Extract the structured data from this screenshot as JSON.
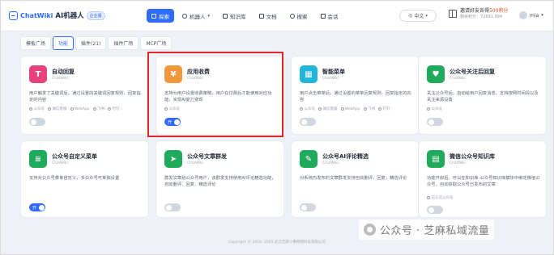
{
  "header": {
    "logo_text": "ChatWiki",
    "logo_title": "AI机器人",
    "logo_badge": "企业版",
    "nav": [
      {
        "label": "探索",
        "active": true
      },
      {
        "label": "机器人",
        "active": false
      },
      {
        "label": "知识库",
        "active": false
      },
      {
        "label": "文档",
        "active": false
      },
      {
        "label": "搜索",
        "active": false
      },
      {
        "label": "会话",
        "active": false
      }
    ],
    "language": "中文",
    "invite_text": "邀请好友各得",
    "invite_points": "500积分",
    "invite_sub": "剩余积分：72891.994",
    "username": "mia"
  },
  "tabs": [
    {
      "label": "模板广场",
      "active": false
    },
    {
      "label": "功能",
      "active": true
    },
    {
      "label": "插件(21)",
      "active": false
    },
    {
      "label": "插件广场",
      "active": false
    },
    {
      "label": "MCP广场",
      "active": false
    }
  ],
  "cards": [
    {
      "title": "自动回复",
      "sub": "ChatWiki",
      "icon": "reply-icon",
      "color": "#e8427a",
      "desc": "用户触发了关键词后，通过设置的关键词回复规则，回复指定的内容",
      "platforms": [
        "公众号",
        "微信客服",
        "WebApp",
        "飞书",
        "钉钉"
      ],
      "toggle_on": false,
      "toggle_label": ""
    },
    {
      "title": "应用收费",
      "sub": "ChatWiki",
      "icon": "yen-icon",
      "color": "#f1983c",
      "desc": "支持为用户设置收费策略，用户在付费后才能使用对应功能，实现AI能力变现",
      "platforms": [
        "公众号"
      ],
      "toggle_on": true,
      "toggle_label": "开"
    },
    {
      "title": "智能菜单",
      "sub": "ChatWiki",
      "icon": "menu-grid-icon",
      "color": "#23b6d9",
      "desc": "用户点击菜单后，通过设置的菜单回复规则，回复指定的内容",
      "platforms": [
        "公众号",
        "微信客服",
        "WebApp",
        "飞书",
        "钉钉"
      ],
      "toggle_on": false,
      "toggle_label": ""
    },
    {
      "title": "公众号关注后回复",
      "sub": "ChatWiki",
      "icon": "heart-chat-icon",
      "color": "#1faa5c",
      "desc": "关注公众号后，自动给用户回复消息，支持按照时间段以及关注来源设置",
      "platforms": [
        "公众号"
      ],
      "toggle_on": false,
      "toggle_label": ""
    },
    {
      "title": "公众号自定义菜单",
      "sub": "ChatWiki",
      "icon": "custom-menu-icon",
      "color": "#1faa5c",
      "desc": "支持对公众号菜单自定义，多公众号可单独设置",
      "platforms": [],
      "toggle_on": true,
      "toggle_label": "开"
    },
    {
      "title": "公众号文章群发",
      "sub": "ChatWiki",
      "icon": "send-icon",
      "color": "#1faa5c",
      "desc": "群发文章给公众号用户，该群发支持使用AI评论精选功能，自动删评、回复、精选评论",
      "platforms": [],
      "toggle_on": false,
      "toggle_label": ""
    },
    {
      "title": "公众号AI评论精选",
      "sub": "ChatWiki",
      "icon": "ai-comment-icon",
      "color": "#1faa5c",
      "desc": "对系统内发布的文章群发支持自动删评，回复，精选评论",
      "platforms": [],
      "toggle_on": false,
      "toggle_label": ""
    },
    {
      "title": "微信公众号知识库",
      "sub": "ChatWiki",
      "icon": "doc-library-icon",
      "color": "#1faa5c",
      "desc": "功能开启后，可以在知识库-公众号知识库模块中绑定微信公众号，自动获取公众号已发布的文章",
      "platforms": [
        "已认证公众号"
      ],
      "toggle_on": false,
      "toggle_label": ""
    }
  ],
  "footer": "Copyright © 2016- 2025 武汉芝麻小事网络科技有限公司",
  "watermark": "公众号 · 芝麻私域流量"
}
